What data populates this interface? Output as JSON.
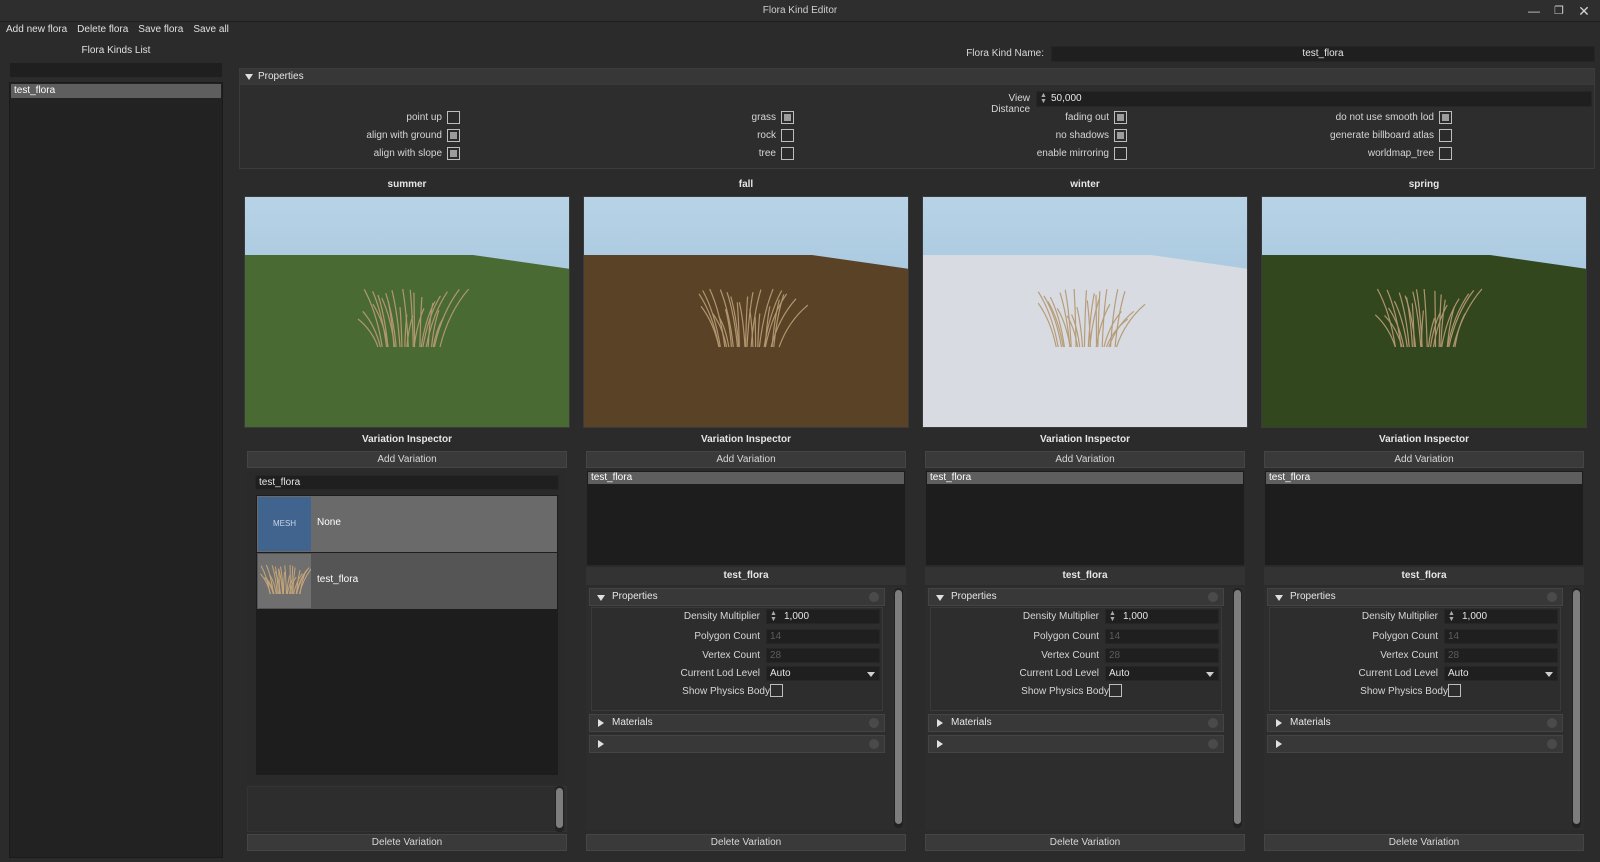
{
  "window": {
    "title": "Flora Kind Editor"
  },
  "menu": {
    "add": "Add new flora",
    "delete": "Delete flora",
    "save": "Save flora",
    "save_all": "Save all"
  },
  "left": {
    "title": "Flora Kinds List",
    "search": "",
    "items": [
      "test_flora"
    ]
  },
  "kind_name": {
    "label": "Flora Kind Name:",
    "value": "test_flora"
  },
  "properties": {
    "header": "Properties",
    "view_distance": {
      "label": "View Distance",
      "value": "50,000"
    },
    "flags": [
      {
        "label": "point up",
        "checked": false
      },
      {
        "label": "align with ground",
        "checked": true
      },
      {
        "label": "align with slope",
        "checked": true
      },
      {
        "label": "grass",
        "checked": true
      },
      {
        "label": "rock",
        "checked": false
      },
      {
        "label": "tree",
        "checked": false
      },
      {
        "label": "fading out",
        "checked": true
      },
      {
        "label": "no shadows",
        "checked": true
      },
      {
        "label": "enable mirroring",
        "checked": false
      },
      {
        "label": "do not use smooth lod",
        "checked": true
      },
      {
        "label": "generate billboard atlas",
        "checked": false
      },
      {
        "label": "worldmap_tree",
        "checked": false
      }
    ]
  },
  "seasons": [
    {
      "name": "summer",
      "ground": "#4a6a34",
      "sky": "#9fc3dc"
    },
    {
      "name": "fall",
      "ground": "#5a4226",
      "sky": "#9fc3dc"
    },
    {
      "name": "winter",
      "ground": "#d9dbe3",
      "sky": "#9fc3dc"
    },
    {
      "name": "spring",
      "ground": "#33471f",
      "sky": "#9fc3dc"
    }
  ],
  "inspector": {
    "title": "Variation Inspector",
    "add_label": "Add Variation",
    "delete_label": "Delete Variation",
    "variation": "test_flora",
    "search_value": "test_flora",
    "mesh_items": [
      {
        "thumb": "MESH",
        "label": "None"
      },
      {
        "thumb": "",
        "label": "test_flora"
      }
    ],
    "props": {
      "header": "Properties",
      "density_label": "Density Multiplier",
      "density_value": "1,000",
      "polygon_label": "Polygon Count",
      "polygon_value": "14",
      "vertex_label": "Vertex Count",
      "vertex_value": "28",
      "lod_label": "Current Lod Level",
      "lod_value": "Auto",
      "physics_label": "Show Physics Body",
      "materials": "Materials"
    }
  },
  "colors": {
    "background": "#2b2b2b",
    "selection": "#5e5e5e",
    "field": "#1f1f1f",
    "mesh_thumb": "#41648f"
  }
}
